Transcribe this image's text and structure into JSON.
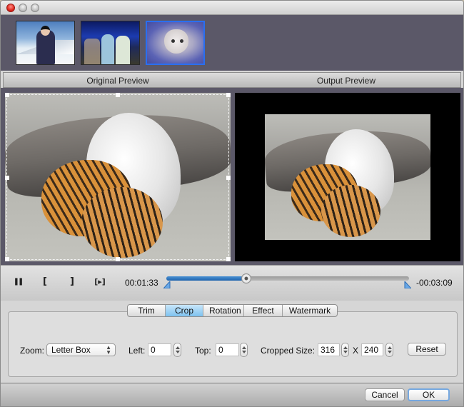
{
  "window": {
    "controls": [
      "close",
      "minimize",
      "zoom"
    ]
  },
  "thumbnails": [
    {
      "name": "skier-video",
      "selected": false
    },
    {
      "name": "wedding-video",
      "selected": false
    },
    {
      "name": "kitten-video",
      "selected": true
    }
  ],
  "preview": {
    "original_label": "Original Preview",
    "output_label": "Output Preview"
  },
  "playback": {
    "pause_icon": "❚❚",
    "mark_in_icon": "[",
    "mark_out_icon": "]",
    "play_segment_icon": "[▸]",
    "elapsed": "00:01:33",
    "remaining": "-00:03:09",
    "progress_fraction": 0.33,
    "accent_color": "#2a6fbd"
  },
  "tabs": [
    {
      "label": "Trim",
      "active": false
    },
    {
      "label": "Crop",
      "active": true
    },
    {
      "label": "Rotation",
      "active": false
    },
    {
      "label": "Effect",
      "active": false
    },
    {
      "label": "Watermark",
      "active": false
    }
  ],
  "crop": {
    "zoom_label": "Zoom:",
    "zoom_value": "Letter Box",
    "left_label": "Left:",
    "left_value": "0",
    "top_label": "Top:",
    "top_value": "0",
    "cropped_size_label": "Cropped Size:",
    "width_value": "316",
    "x_label": "X",
    "height_value": "240",
    "reset_label": "Reset"
  },
  "footer": {
    "cancel_label": "Cancel",
    "ok_label": "OK"
  }
}
